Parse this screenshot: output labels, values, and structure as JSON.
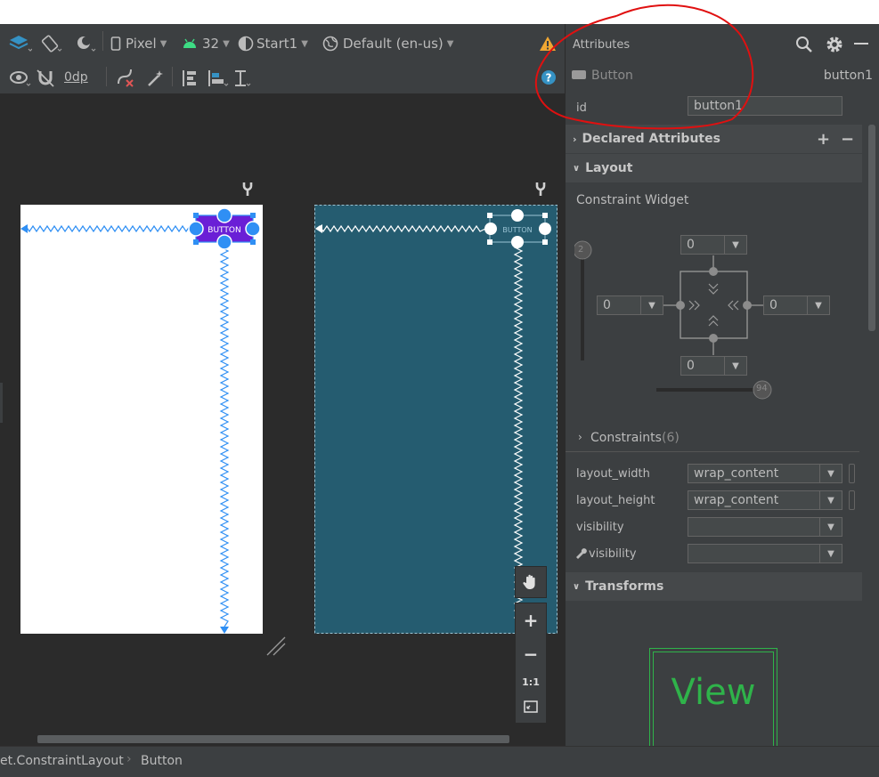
{
  "toolbar": {
    "device": "Pixel",
    "api_level": "32",
    "theme": "Start1",
    "locale": "Default (en-us)",
    "margin": "0dp"
  },
  "canvas": {
    "button_text": "BUTTON"
  },
  "attributes": {
    "panel_title": "Attributes",
    "component_type": "Button",
    "component_id": "button1",
    "id_label": "id",
    "id_value": "button1",
    "declared_section": "Declared Attributes",
    "layout_section": "Layout",
    "constraint_widget_label": "Constraint Widget",
    "bias_vertical": "2",
    "bias_horizontal": "94",
    "margin_top": "0",
    "margin_left": "0",
    "margin_right": "0",
    "margin_bottom": "0",
    "constraints_label": "Constraints",
    "constraints_count": "(6)",
    "layout_width_label": "layout_width",
    "layout_width_value": "wrap_content",
    "layout_height_label": "layout_height",
    "layout_height_value": "wrap_content",
    "visibility_label": "visibility",
    "tools_visibility_label": "visibility",
    "transforms_section": "Transforms",
    "view_preview": "View"
  },
  "zoom_controls": {
    "fit_label": "1:1"
  },
  "breadcrumb": {
    "parent": "et.ConstraintLayout",
    "separator": "›",
    "current": "Button"
  },
  "colors": {
    "accent_blue": "#2f8ff4",
    "button_purple": "#6a1fd6",
    "blueprint": "#255c70",
    "annotation_red": "#e01010",
    "preview_green": "#2fb34a"
  }
}
